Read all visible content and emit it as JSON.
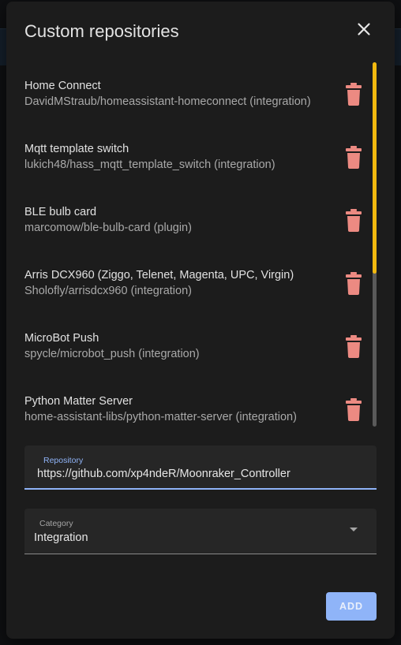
{
  "dialog": {
    "title": "Custom repositories"
  },
  "repositories": [
    {
      "name": "Home Connect",
      "path": "DavidMStraub/homeassistant-homeconnect (integration)"
    },
    {
      "name": "Mqtt template switch",
      "path": "lukich48/hass_mqtt_template_switch (integration)"
    },
    {
      "name": "BLE bulb card",
      "path": "marcomow/ble-bulb-card (plugin)"
    },
    {
      "name": "Arris DCX960 (Ziggo, Telenet, Magenta, UPC, Virgin)",
      "path": "Sholofly/arrisdcx960 (integration)"
    },
    {
      "name": "MicroBot Push",
      "path": "spycle/microbot_push (integration)"
    },
    {
      "name": "Python Matter Server",
      "path": "home-assistant-libs/python-matter-server (integration)"
    }
  ],
  "scroll": {
    "visible_fraction": 0.58
  },
  "repository_field": {
    "label": "Repository",
    "value": "https://github.com/xp4ndeR/Moonraker_Controller"
  },
  "category_field": {
    "label": "Category",
    "value": "Integration"
  },
  "actions": {
    "add_label": "ADD"
  },
  "icons": {
    "close": "close-icon",
    "delete": "trash-icon",
    "dropdown": "dropdown-arrow-icon"
  },
  "colors": {
    "accent": "#8fb3f7",
    "delete": "#ec8a82",
    "scroll_thumb": "#f2b90f",
    "dialog_bg": "#1c1c1c"
  }
}
